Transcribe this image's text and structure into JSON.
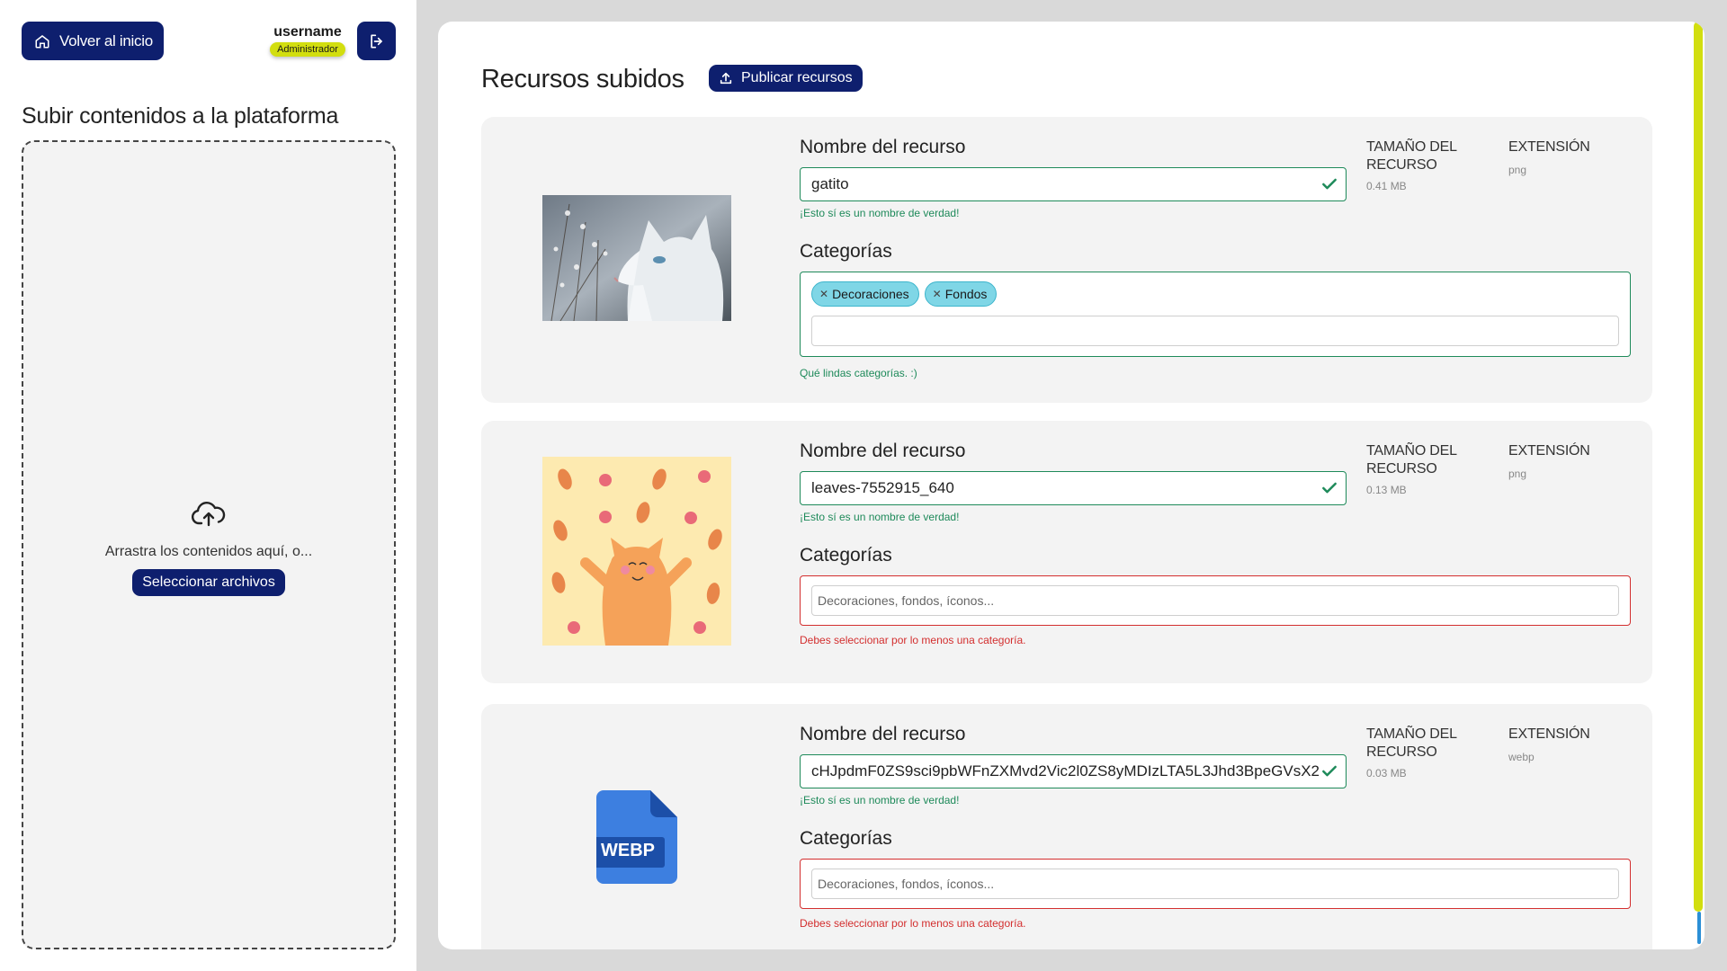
{
  "sidebar": {
    "home_label": "Volver al inicio",
    "username": "username",
    "role": "Administrador",
    "upload_title": "Subir contenidos a la plataforma",
    "dropzone_text": "Arrastra los contenidos aquí, o...",
    "select_label": "Seleccionar archivos"
  },
  "main": {
    "title": "Recursos subidos",
    "publish_label": "Publicar recursos",
    "resources": [
      {
        "name_label": "Nombre del recurso",
        "name_value": "gatito",
        "name_help": "¡Esto sí es un nombre de verdad!",
        "size_label": "TAMAÑO DEL RECURSO",
        "size_value": "0.41 MB",
        "ext_label": "EXTENSIÓN",
        "ext_value": "png",
        "cat_label": "Categorías",
        "chips": [
          "Decoraciones",
          "Fondos"
        ],
        "cat_help": "Qué lindas categorías. :)"
      },
      {
        "name_label": "Nombre del recurso",
        "name_value": "leaves-7552915_640",
        "name_help": "¡Esto sí es un nombre de verdad!",
        "size_label": "TAMAÑO DEL RECURSO",
        "size_value": "0.13 MB",
        "ext_label": "EXTENSIÓN",
        "ext_value": "png",
        "cat_label": "Categorías",
        "cat_placeholder": "Decoraciones, fondos, íconos...",
        "cat_help": "Debes seleccionar por lo menos una categoría."
      },
      {
        "name_label": "Nombre del recurso",
        "name_value": "cHJpdmF0ZS9sci9pbWFnZXMvd2Vic2l0ZS8yMDIzLTA5L3Jhd3BpeGVsX2",
        "name_help": "¡Esto sí es un nombre de verdad!",
        "size_label": "TAMAÑO DEL RECURSO",
        "size_value": "0.03 MB",
        "ext_label": "EXTENSIÓN",
        "ext_value": "webp",
        "cat_label": "Categorías",
        "cat_placeholder": "Decoraciones, fondos, íconos...",
        "cat_help": "Debes seleccionar por lo menos una categoría.",
        "file_icon_text": "WEBP"
      }
    ]
  },
  "colors": {
    "primary": "#0e1f6e",
    "accent": "#d2de0f",
    "success": "#1e8a5a",
    "error": "#d32f2f",
    "chip": "#7fd6e6"
  }
}
